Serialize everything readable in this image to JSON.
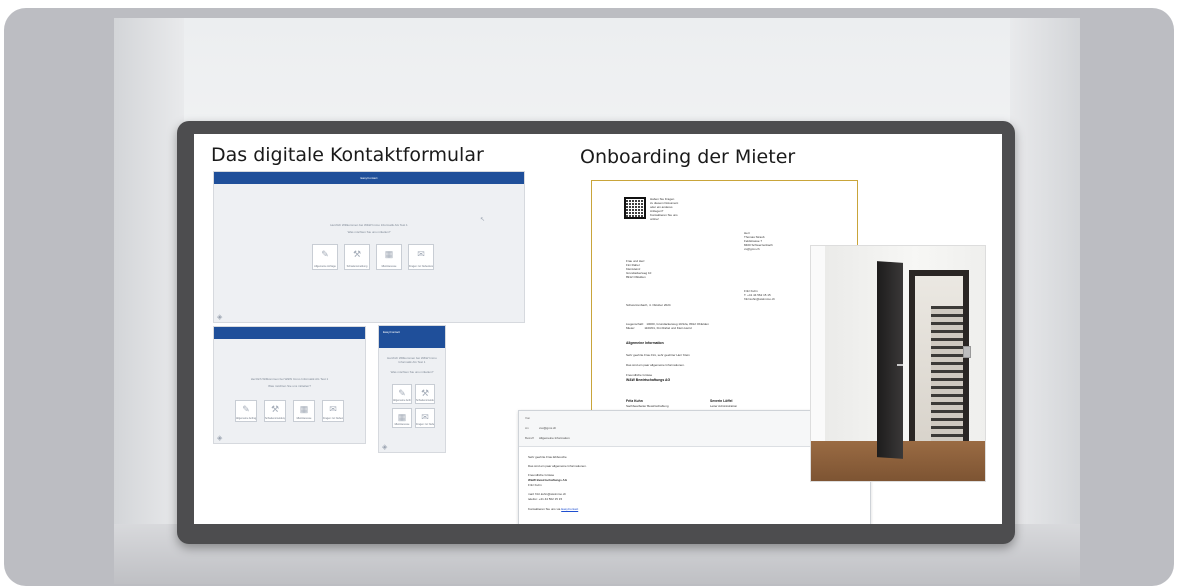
{
  "headings": {
    "left": "Das digitale Kontaktformular",
    "right": "Onboarding der Mieter"
  },
  "form_desktop": {
    "bar_title": "EasyContact",
    "welcome": "Herzlich Willkommen bei W&W Immo Informatik AG Test 1",
    "question": "Was möchten Sie uns mitteilen?",
    "tiles": [
      "Allgemeine Anfrage",
      "Schadensmeldung",
      "Mietinteresse",
      "Fragen zur Nebenkosten"
    ]
  },
  "form_tablet": {
    "welcome": "Herzlich Willkommen bei W&W Immo Informatik AG Test 1",
    "question": "Was möchten Sie uns mitteilen?",
    "tiles": [
      "Allgemeine Anfrage",
      "Schadensmeldung",
      "Mietinteresse",
      "Fragen zur Nebenkosten"
    ]
  },
  "form_mobile": {
    "bar_title": "EasyContact",
    "welcome": "Herzlich Willkommen bei W&W Immo Informatik AG Test 1",
    "question": "Was möchten Sie uns mitteilen?",
    "tiles": [
      "Allgemeine Anfrage",
      "Schadensmeldung",
      "Mietinteresse",
      "Fragen zur Nebenkosten"
    ]
  },
  "letter": {
    "qr_note": "Haben Sie Fragen\nzu diesem Dokument\noder ein anderes\nAnliegen?\nKontaktieren Sie uns\nonline!",
    "recipient": "Herr\nThomas Straub\nFeldstrasse 7\n8400 Schwerzenbach\nxx@gmx.ch",
    "sender": "Frau und Herr\nFini Rahel\nKleinHeinz\nGrundackerweg 10\n8912 Obfelden",
    "date_line": "Schwerzenbach, 4. Oktober 2024",
    "contact": "Fritz Kuhn\nT. +41 44 562 15 15\nfritz.kuhn@wwimmo.ch",
    "property": "Liegenschaft:   10000, Grundackerweg 10/12a, 8912 Obfelden\nMieter:           1100/01, Fini Rahel und Klein Heinz",
    "subject": "Allgemeine Information",
    "salutation": "Sehr geehrte Frau Fini, sehr geehrter Herr Klein",
    "body": "Das sind ein paar allgemeine Informationen.",
    "closing": "Freundliche Grüsse",
    "company": "W&W Bewirtschaftungs AG",
    "sig1_name": "Fritz Kuhn",
    "sig1_role": "Sachbearbeiter Bewirtschaftung",
    "sig2_name": "Severin Löffel",
    "sig2_role": "Leiter Administration"
  },
  "email": {
    "von_label": "Von",
    "an_label": "An",
    "an_value": "xxx@gmx.ch",
    "betreff_label": "Betreff",
    "betreff_value": "Allgemeine Information",
    "lines": [
      "Sehr geehrte Frau Ebbouche",
      "Das sind ein paar allgemeine Informationen.",
      "Freundliche Grüsse",
      "W&W Bewirtschaftungs AG",
      "Fritz Kuhn",
      "mail: fritz.kuhn@wwimmo.ch",
      "telefon: +41 44 562 15 15",
      "Kontaktieren Sie uns via"
    ],
    "link": "EasyContact"
  }
}
